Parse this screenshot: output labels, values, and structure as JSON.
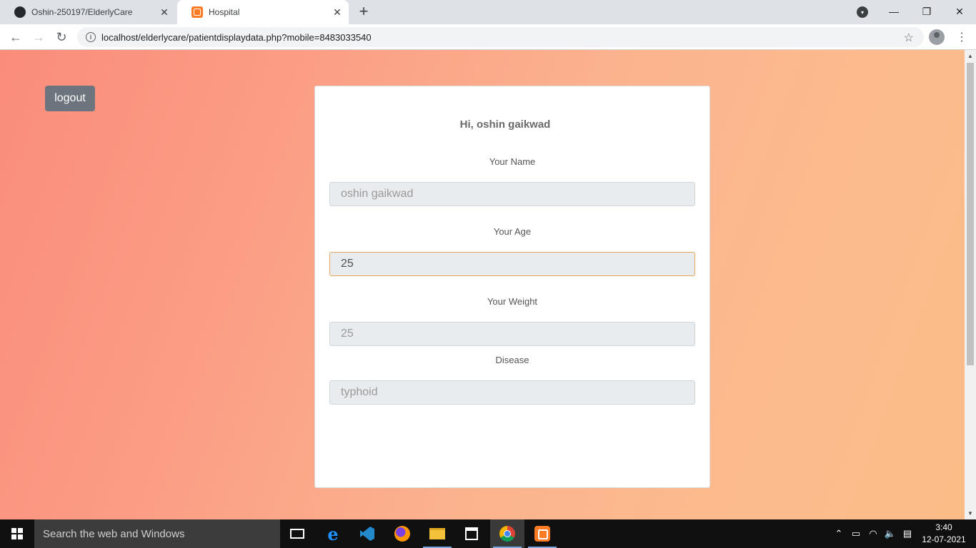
{
  "browser": {
    "tabs": [
      {
        "title": "Oshin-250197/ElderlyCare",
        "icon": "github-icon",
        "active": false
      },
      {
        "title": "Hospital",
        "icon": "xampp-icon",
        "active": true
      }
    ],
    "new_tab_symbol": "+",
    "address": "localhost/elderlycare/patientdisplaydata.php?mobile=8483033540",
    "window_controls": {
      "minimize": "—",
      "restore": "❐",
      "close": "✕"
    }
  },
  "page": {
    "logout_label": "logout",
    "greeting": "Hi, oshin gaikwad",
    "fields": {
      "name": {
        "label": "Your Name",
        "value": "oshin gaikwad"
      },
      "age": {
        "label": "Your Age",
        "value": "25"
      },
      "weight": {
        "label": "Your Weight",
        "value": "25"
      },
      "disease": {
        "label": "Disease",
        "value": "typhoid"
      }
    }
  },
  "taskbar": {
    "search_placeholder": "Search the web and Windows",
    "time": "3:40",
    "date": "12-07-2021"
  },
  "colors": {
    "logout_button": "#6c757d",
    "focused_border": "#e8a75c",
    "background_gradient_start": "#fa8c7c",
    "background_gradient_end": "#fcbc88"
  }
}
